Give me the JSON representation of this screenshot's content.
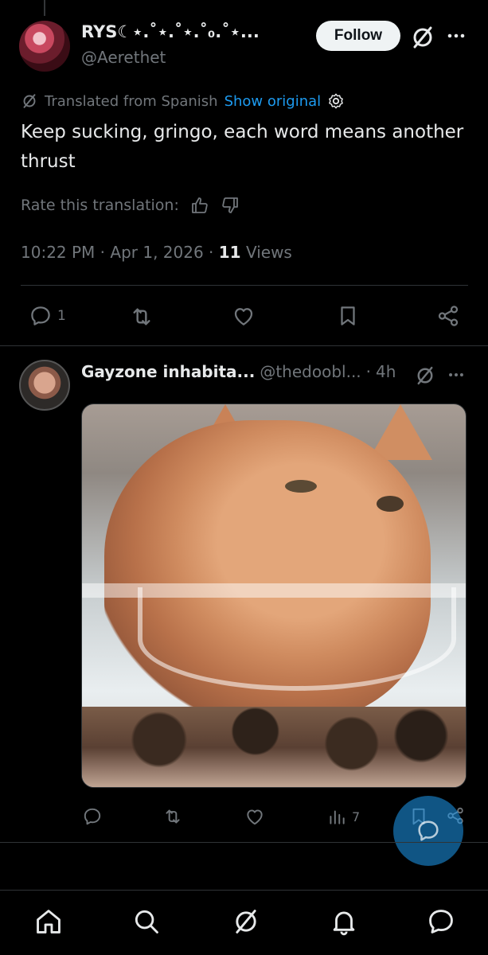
{
  "tweet": {
    "display_name": "RYS☾⋆.˚⋆.˚⋆.˚₀.˚⋆...",
    "handle": "@Aerethet",
    "follow_label": "Follow",
    "translated_label": "Translated from Spanish",
    "show_original_label": "Show original",
    "text": "Keep sucking, gringo, each word means another thrust",
    "rate_label": "Rate this translation:",
    "time": "10:22 PM",
    "date": "Apr 1, 2026",
    "views_count": "11",
    "views_label": "Views",
    "reply_count": "1"
  },
  "reply_tweet": {
    "display_name": "Gayzone inhabita...",
    "handle": "@thedoobl...",
    "time": "4h",
    "views_count": "7"
  },
  "icons": {
    "grok": "grok-icon",
    "more": "more-icon",
    "settings": "gear-icon",
    "thumbs_up": "thumbs-up-icon",
    "thumbs_down": "thumbs-down-icon",
    "reply": "reply-icon",
    "retweet": "retweet-icon",
    "like": "heart-icon",
    "bookmark": "bookmark-icon",
    "share": "share-icon",
    "views": "views-icon",
    "home": "home-icon",
    "search": "search-icon",
    "notifications": "bell-icon",
    "messages": "messages-icon",
    "compose": "compose-icon"
  },
  "colors": {
    "background": "#000000",
    "text": "#e7e9ea",
    "muted": "#71767b",
    "accent": "#1d9bf0"
  }
}
